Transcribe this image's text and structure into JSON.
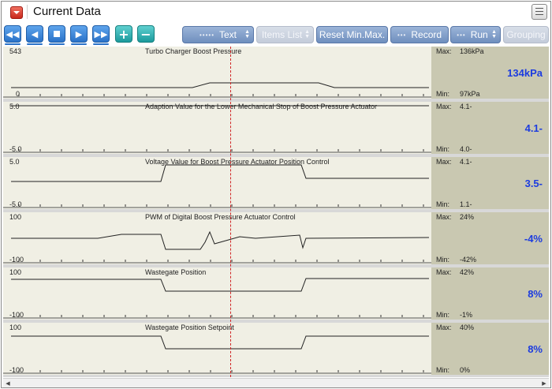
{
  "window": {
    "title": "Current Data"
  },
  "toolbar": {
    "text_label": "Text",
    "items_list_label": "Items List",
    "reset_label": "Reset Min.Max.",
    "record_label": "Record",
    "run_label": "Run",
    "grouping_label": "Grouping",
    "plus_label": "+",
    "minus_label": "−"
  },
  "channels": [
    {
      "name": "Turbo Charger Boost Pressure",
      "scale_top": "543",
      "scale_bottom": "0",
      "max_label": "Max:",
      "max": "136kPa",
      "value": "134kPa",
      "min_label": "Min:",
      "min": "97kPa"
    },
    {
      "name": "Adaption Value for the Lower Mechanical Stop of Boost Pressure Actuator",
      "scale_top": "5.0",
      "scale_bottom": "-5.0",
      "max_label": "Max:",
      "max": "4.1-",
      "value": "4.1-",
      "min_label": "Min:",
      "min": "4.0-"
    },
    {
      "name": "Voltage Value for Boost Pressure Actuator Position Control",
      "scale_top": "5.0",
      "scale_bottom": "-5.0",
      "max_label": "Max:",
      "max": "4.1-",
      "value": "3.5-",
      "min_label": "Min:",
      "min": "1.1-"
    },
    {
      "name": "PWM of Digital Boost Pressure Actuator Control",
      "scale_top": "100",
      "scale_bottom": "-100",
      "max_label": "Max:",
      "max": "24%",
      "value": "-4%",
      "min_label": "Min:",
      "min": "-42%"
    },
    {
      "name": "Wastegate Position",
      "scale_top": "100",
      "scale_bottom": "-100",
      "max_label": "Max:",
      "max": "42%",
      "value": "8%",
      "min_label": "Min:",
      "min": "-1%"
    },
    {
      "name": "Wastegate Position Setpoint",
      "scale_top": "100",
      "scale_bottom": "-100",
      "max_label": "Max:",
      "max": "40%",
      "value": "8%",
      "min_label": "Min:",
      "min": "0%"
    }
  ],
  "colors": {
    "value_text": "#1c3ce0",
    "cursor": "#d02424",
    "button": "#2a72c8"
  }
}
